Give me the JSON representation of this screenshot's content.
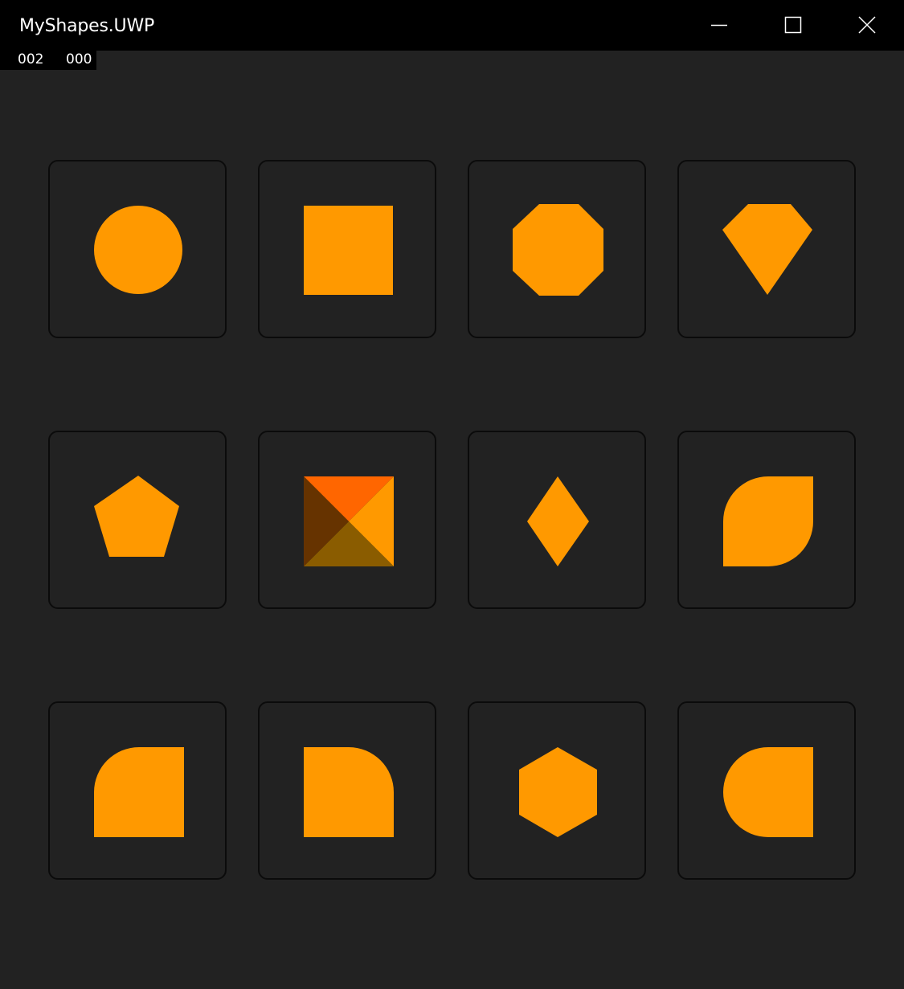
{
  "window": {
    "title": "MyShapes.UWP",
    "controls": [
      {
        "name": "minimize",
        "icon": "minimize-icon"
      },
      {
        "name": "maximize",
        "icon": "maximize-icon"
      },
      {
        "name": "close",
        "icon": "close-icon"
      }
    ]
  },
  "counters": {
    "left": "002",
    "right": "000"
  },
  "colors": {
    "background": "#222222",
    "tile_border": "#0b0b0b",
    "shape_fill": "#FF9900",
    "pyramid_top": "#FF6600",
    "pyramid_right": "#FF9900",
    "pyramid_bottom": "#8A5C00",
    "pyramid_left": "#663300"
  },
  "shapes": [
    {
      "shape": "circle"
    },
    {
      "shape": "square"
    },
    {
      "shape": "octagon"
    },
    {
      "shape": "diamond-gem"
    },
    {
      "shape": "pentagon"
    },
    {
      "shape": "pyramid"
    },
    {
      "shape": "rhombus"
    },
    {
      "shape": "leaf"
    },
    {
      "shape": "rounded-top-left"
    },
    {
      "shape": "rounded-top-right"
    },
    {
      "shape": "hexagon"
    },
    {
      "shape": "rounded-left-half"
    }
  ]
}
